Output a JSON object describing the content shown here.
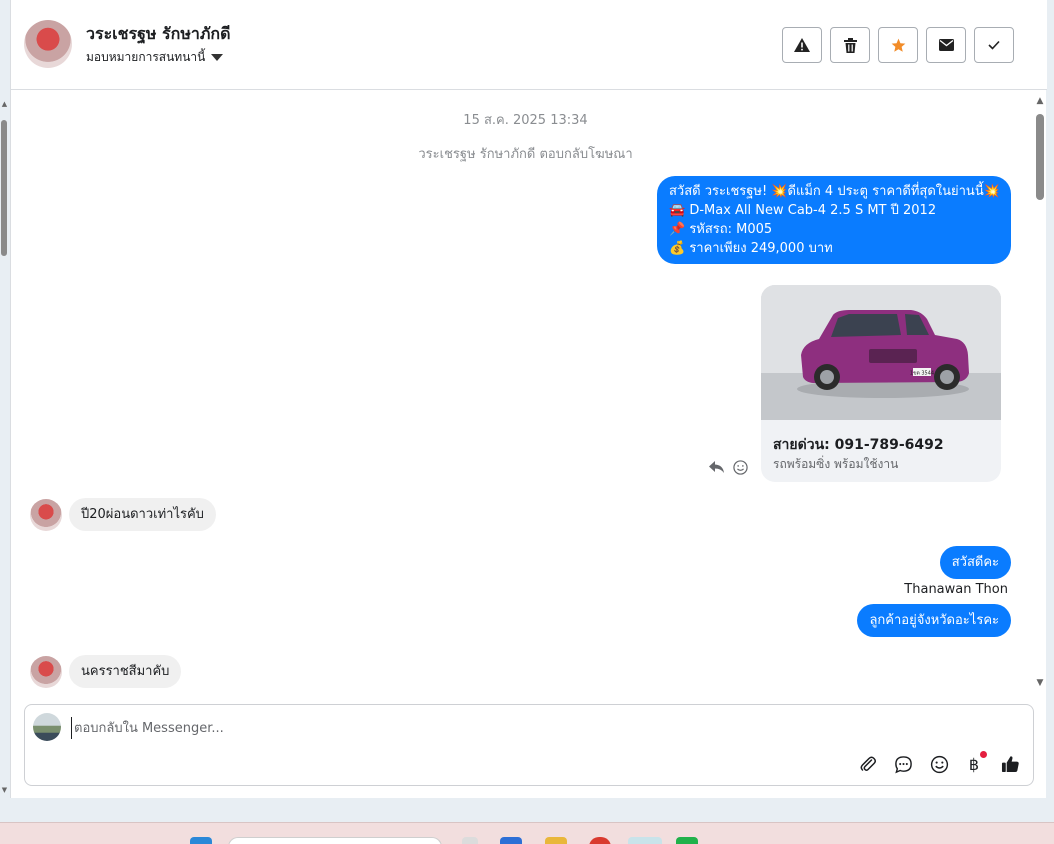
{
  "header": {
    "contact_name": "วระเชรฐษ รักษาภักดี",
    "assign_label": "มอบหมายการสนทนานี้"
  },
  "chat": {
    "timestamp": "15 ส.ค. 2025 13:34",
    "system_note": "วระเชรฐษ รักษาภักดี ตอบกลับโฆษณา",
    "ad_message_lines": [
      "สวัสดี วระเชรฐษ! 💥ดีแม็ก 4 ประตู ราคาดีที่สุดในย่านนี้💥",
      "🚘 D-Max All New Cab-4 2.5 S MT  ปี 2012",
      "📌 รหัสรถ: M005",
      "💰 ราคาเพียง 249,000 บาท"
    ],
    "card": {
      "plate": "1ขต 3544",
      "phone": "สายด่วน: 091-789-6492",
      "subtitle": "รถพร้อมซิ่ง พร้อมใช้งาน"
    },
    "incoming_1": "ปี20ผ่อนดาวเท่าไรคับ",
    "outgoing_1": "สวัสดีคะ",
    "sender_name": "Thanawan Thon",
    "outgoing_2": "ลูกค้าอยู่จังหวัดอะไรคะ",
    "incoming_2": "นครราชสีมาคับ"
  },
  "composer": {
    "placeholder": "ตอบกลับใน Messenger..."
  },
  "colors": {
    "outgoing_bubble": "#0a7cff",
    "incoming_bubble": "#f0f0f0",
    "star": "#f28c28"
  },
  "icons": {
    "toolbar": [
      "warning-icon",
      "trash-icon",
      "star-icon",
      "envelope-icon",
      "check-icon"
    ],
    "composer": [
      "paperclip-icon",
      "chat-bubble-icon",
      "emoji-icon",
      "baht-icon",
      "thumbs-up-icon"
    ]
  }
}
